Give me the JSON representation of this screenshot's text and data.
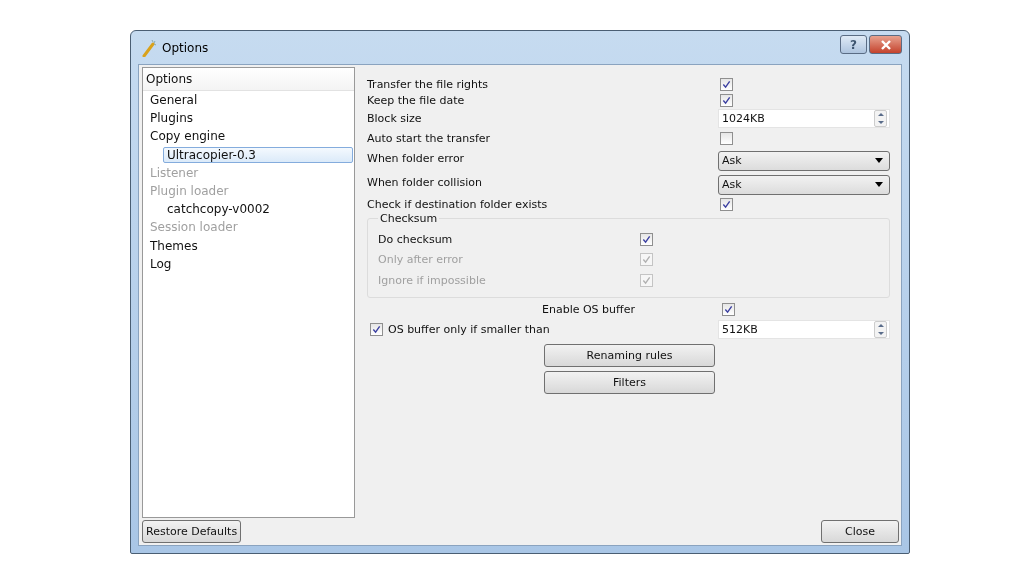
{
  "window": {
    "title": "Options",
    "help_button": "?"
  },
  "tree": {
    "header": "Options",
    "items": [
      {
        "label": "General",
        "disabled": false,
        "selected": false
      },
      {
        "label": "Plugins",
        "disabled": false,
        "selected": false
      },
      {
        "label": "Copy engine",
        "disabled": false,
        "selected": false,
        "children": [
          {
            "label": "Ultracopier-0.3",
            "disabled": false,
            "selected": true
          }
        ]
      },
      {
        "label": "Listener",
        "disabled": true,
        "selected": false
      },
      {
        "label": "Plugin loader",
        "disabled": true,
        "selected": false,
        "children": [
          {
            "label": "catchcopy-v0002",
            "disabled": false,
            "selected": false
          }
        ]
      },
      {
        "label": "Session loader",
        "disabled": true,
        "selected": false
      },
      {
        "label": "Themes",
        "disabled": false,
        "selected": false
      },
      {
        "label": "Log",
        "disabled": false,
        "selected": false
      }
    ]
  },
  "settings": [
    {
      "kind": "checkbox",
      "label": "Transfer the file rights",
      "checked": true
    },
    {
      "kind": "checkbox",
      "label": "Keep the file date",
      "checked": true
    },
    {
      "kind": "spin",
      "label": "Block size",
      "value": "1024KB"
    },
    {
      "kind": "checkbox",
      "label": "Auto start the transfer",
      "checked": false
    },
    {
      "kind": "combo",
      "label": "When folder error",
      "value": "Ask"
    },
    {
      "kind": "combo",
      "label": "When folder collision",
      "value": "Ask"
    },
    {
      "kind": "checkbox",
      "label": "Check if destination folder exists",
      "checked": true
    }
  ],
  "checksum": {
    "title": "Checksum",
    "items": [
      {
        "label": "Do checksum",
        "checked": true,
        "disabled": false
      },
      {
        "label": "Only after error",
        "checked": true,
        "disabled": true
      },
      {
        "label": "Ignore if impossible",
        "checked": true,
        "disabled": true
      }
    ]
  },
  "os_buffer": {
    "label": "Enable OS buffer",
    "checked": true
  },
  "os_buffer_limit": {
    "label": "OS buffer only if smaller than",
    "checked": true,
    "value": "512KB"
  },
  "buttons": [
    "Renaming rules",
    "Filters"
  ],
  "footer": {
    "restore": "Restore Defaults",
    "close": "Close"
  }
}
